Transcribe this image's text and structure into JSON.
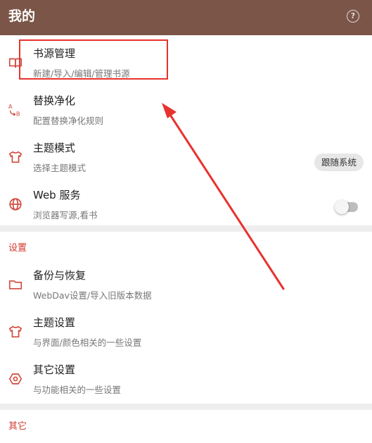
{
  "appbar": {
    "title": "我的",
    "help_icon": "help-circle-icon",
    "help_glyph": "?"
  },
  "main_items": [
    {
      "label": "书源管理",
      "summary": "新建/导入/编辑/管理书源",
      "icon": "book-icon"
    },
    {
      "label": "替换净化",
      "summary": "配置替换净化规则",
      "icon": "replace-ab-icon"
    },
    {
      "label": "主题模式",
      "summary": "选择主题模式",
      "icon": "shirt-icon",
      "chip": "跟随系统"
    },
    {
      "label": "Web 服务",
      "summary": "浏览器写源,看书",
      "icon": "globe-icon",
      "toggle_on": false
    }
  ],
  "settings": {
    "title": "设置",
    "items": [
      {
        "label": "备份与恢复",
        "summary": "WebDav设置/导入旧版本数据",
        "icon": "folder-icon"
      },
      {
        "label": "主题设置",
        "summary": "与界面/颜色相关的一些设置",
        "icon": "shirt-icon"
      },
      {
        "label": "其它设置",
        "summary": "与功能相关的一些设置",
        "icon": "hexagon-settings-icon"
      }
    ]
  },
  "other": {
    "title": "其它"
  },
  "colors": {
    "appbar": "#7a5548",
    "accent": "#d03a2e",
    "annotation": "#e8322d"
  }
}
